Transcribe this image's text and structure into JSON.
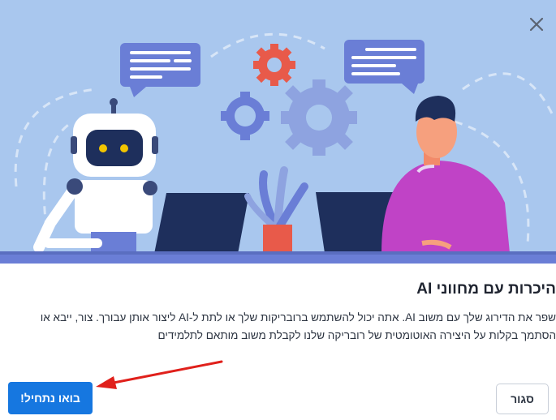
{
  "dialog": {
    "title": "היכרות עם מחווני AI",
    "description_line1": "שפר את הדירוג שלך עם משוב AI. אתה יכול להשתמש ברובריקות שלך או לתת ל-AI ליצור אותן עבורך. צור, ייבא או",
    "description_line2": "הסתמך בקלות על היצירה האוטומטית של רובריקה שלנו לקבלת משוב מותאם לתלמידים",
    "start_button": "בואו נתחיל!",
    "close_button": "סגור"
  },
  "icons": {
    "close": "close-icon",
    "annotation": "red-arrow-annotation"
  },
  "colors": {
    "hero_bg": "#a9c7ee",
    "primary": "#1677e0",
    "annotation": "#e0201b"
  }
}
